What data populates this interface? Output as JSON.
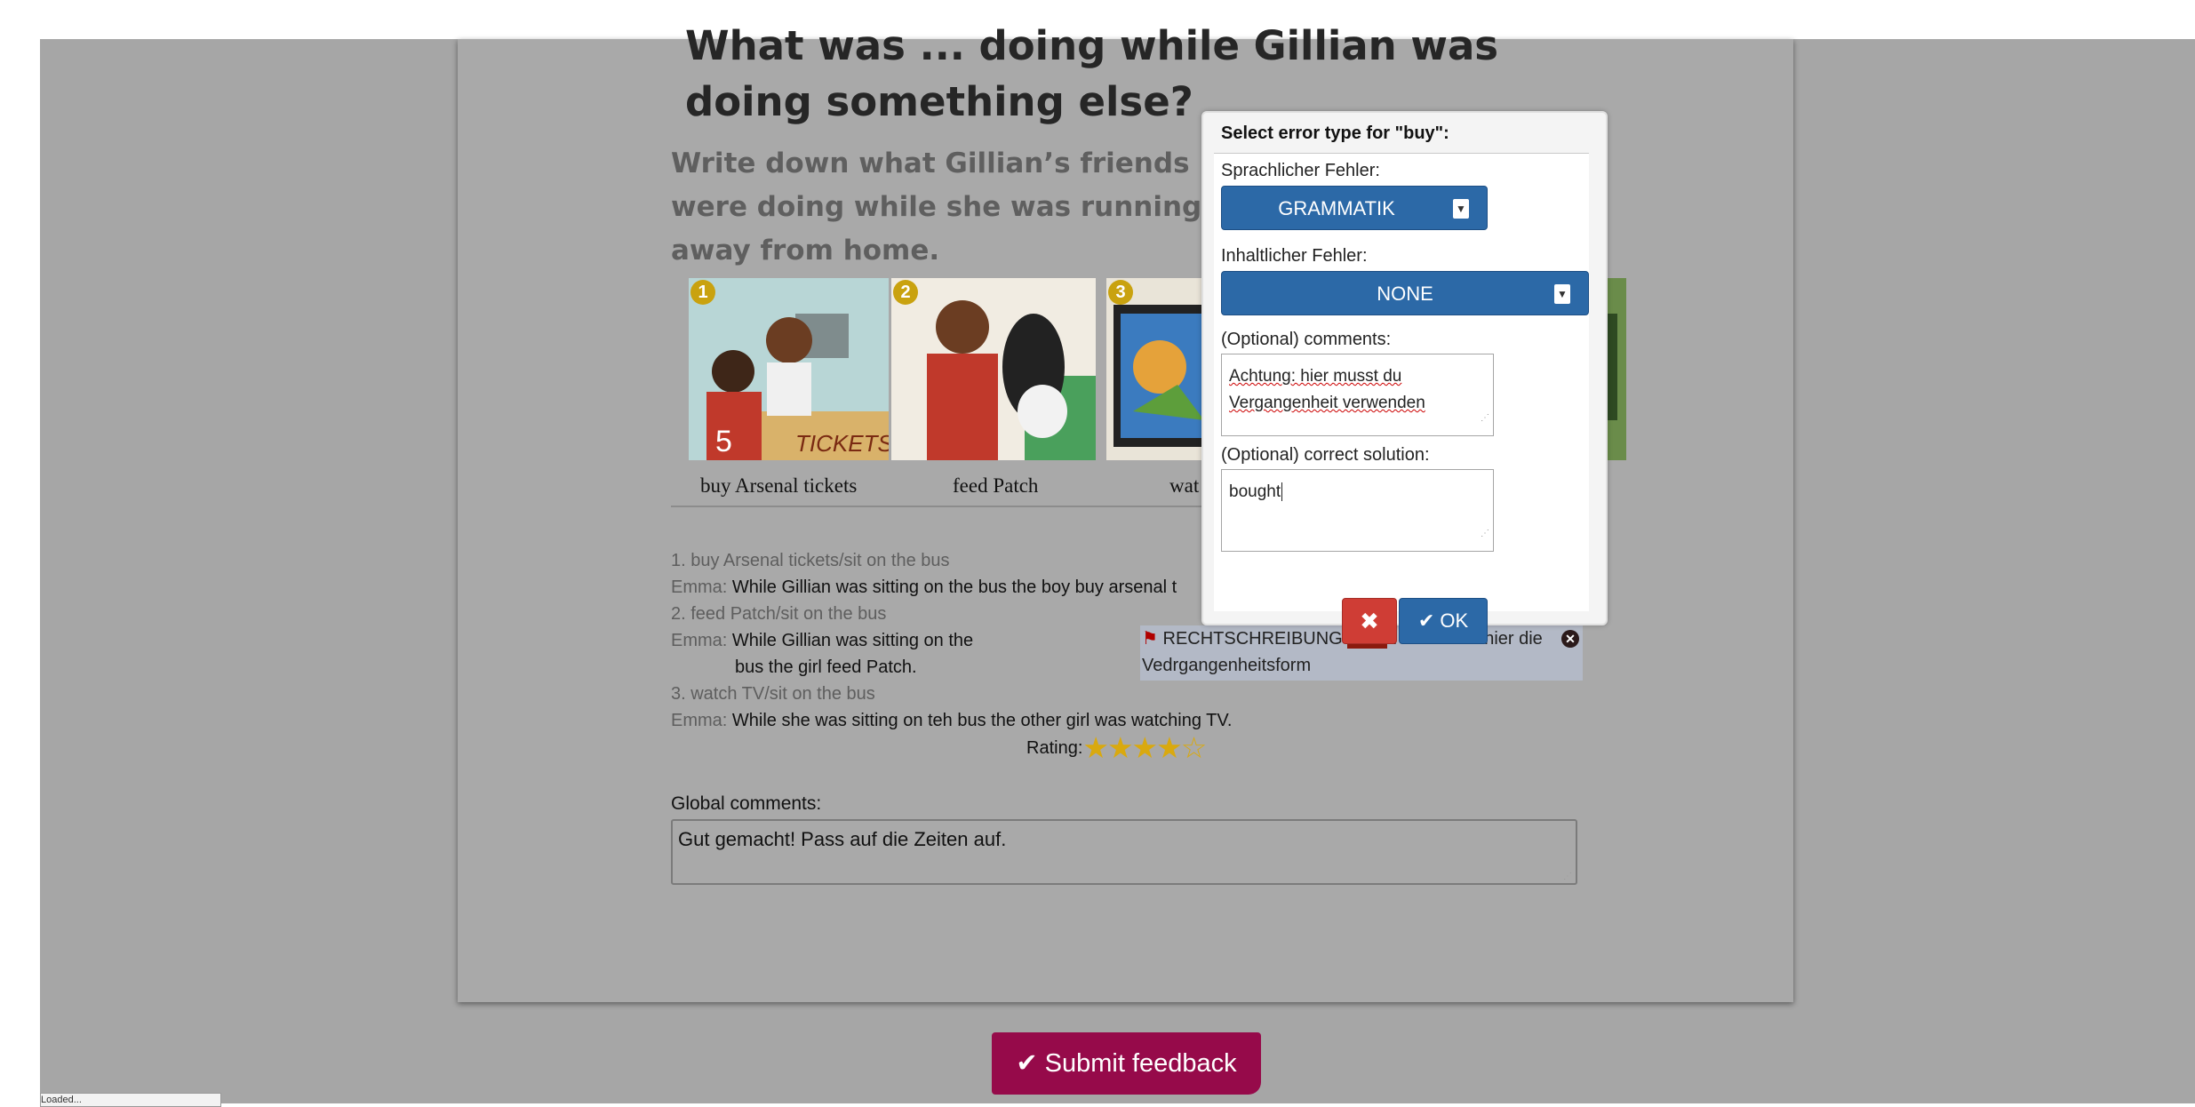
{
  "question": {
    "title": "What was ... doing while Gillian was doing something else?",
    "subtitle": "Write down what Gillian’s friends were doing while she was running away from home."
  },
  "pictures": [
    {
      "number": "1",
      "caption": "buy Arsenal tickets"
    },
    {
      "number": "2",
      "caption": "feed Patch"
    },
    {
      "number": "3",
      "caption": "wat"
    }
  ],
  "exercise": {
    "item1_prompt": "1. buy Arsenal tickets/sit on the bus",
    "item1_speaker": "Emma:",
    "item1_answer": "While Gillian was sitting on the bus the boy buy arsenal t",
    "item2_prompt": "2. feed Patch/sit on the bus",
    "item2_speaker": "Emma:",
    "item2_answer_line1": "While Gillian was sitting on the",
    "item2_answer_line2": "bus the girl feed Patch.",
    "item3_prompt": "3. watch TV/sit on the bus",
    "item3_speaker": "Emma:",
    "item3_answer": "While she was sitting on teh bus the other girl was watching TV."
  },
  "flag_note": {
    "type": "RECHTSCHREIBUNG",
    "highlight": "feed",
    "text": ": verwende hier die Vedrgangenheitsform",
    "flag_color": "#b00000"
  },
  "rating": {
    "label": "Rating:",
    "value": 4,
    "max": 5,
    "stars_display": "★★★★☆"
  },
  "global_comments": {
    "label": "Global comments:",
    "value": "Gut gemacht! Pass auf die Zeiten auf."
  },
  "submit": {
    "label": "✔ Submit feedback",
    "color": "#960a4a"
  },
  "modal": {
    "header": "Select error type for \"buy\":",
    "linguistic_label": "Sprachlicher Fehler:",
    "linguistic_value": "GRAMMATIK",
    "content_label": "Inhaltlicher Fehler:",
    "content_value": "NONE",
    "comments_label": "(Optional) comments:",
    "comments_value": "Achtung: hier musst du Vergangenheit verwenden",
    "solution_label": "(Optional) correct solution:",
    "solution_value": "bought",
    "cancel_label": "✖",
    "ok_label": "✔ OK",
    "accent_color": "#2c69a7",
    "cancel_color": "#cf3d35"
  },
  "status_tip": "Loaded..."
}
